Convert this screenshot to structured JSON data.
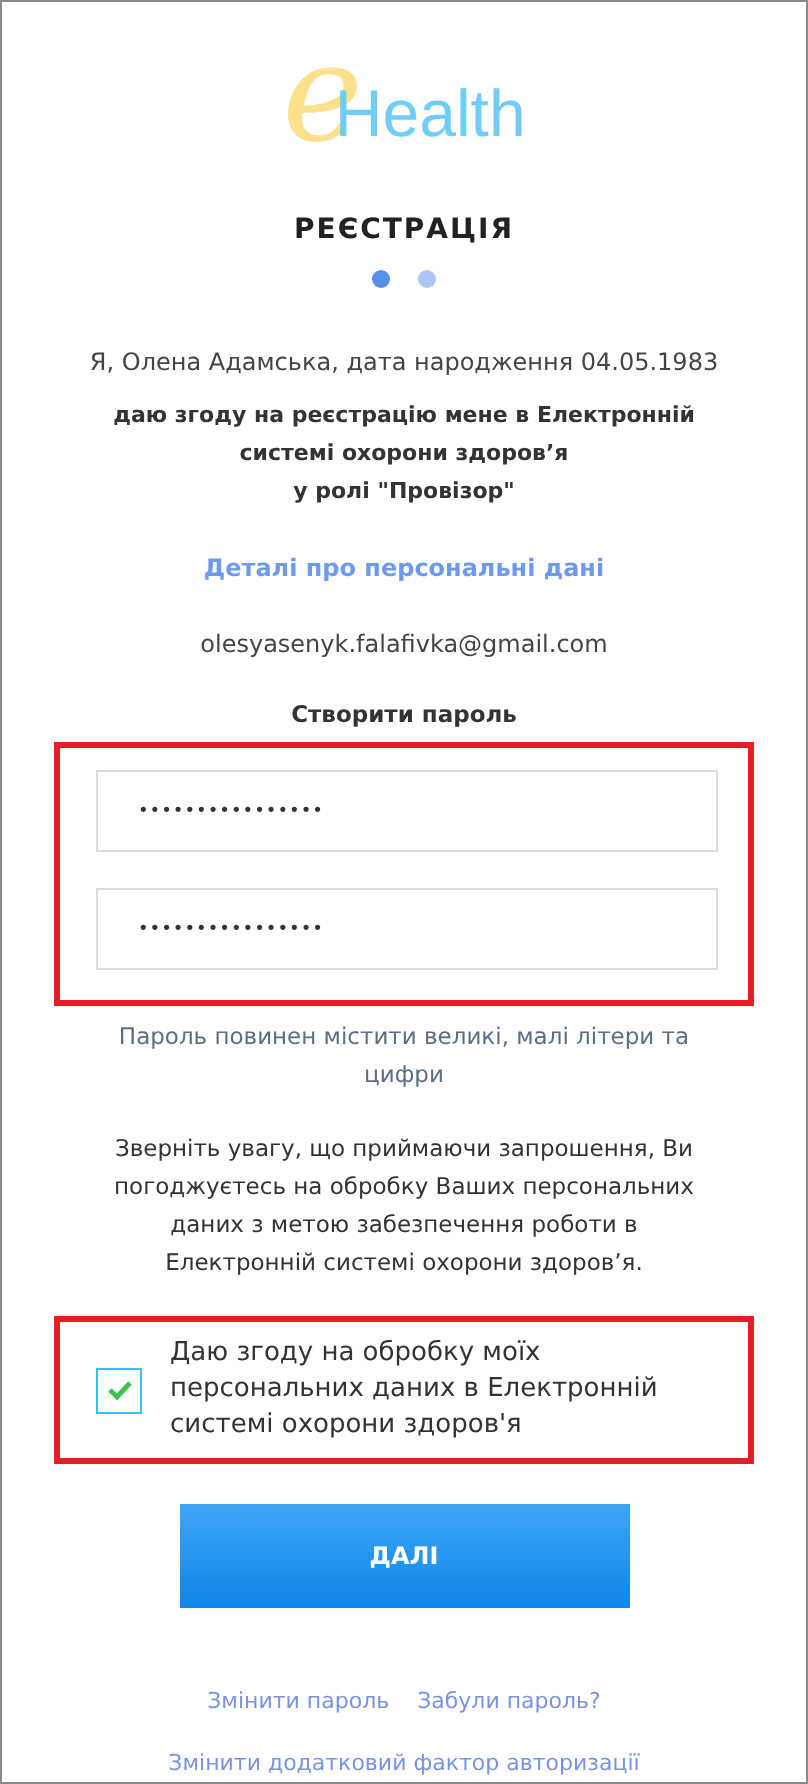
{
  "logo": {
    "mark": "e",
    "word": "Health"
  },
  "title": "РЕЄСТРАЦІЯ",
  "steps": [
    {
      "selected": true
    },
    {
      "selected": false
    }
  ],
  "identity": "Я, Олена Адамська, дата народження 04.05.1983",
  "consent_statement": "даю згоду на реєстрацію мене в Електронній системі охорони здоров’я\nу ролі \"Провізор\"",
  "details_link": "Деталі про персональні дані",
  "email": "olesyasenyk.falafivka@gmail.com",
  "password_heading": "Створити пароль",
  "password_fields": [
    {
      "value": "••••••••••••••••"
    },
    {
      "value": "••••••••••••••••"
    }
  ],
  "password_hint": "Пароль повинен містити великі, малі літери та цифри",
  "notice": "Зверніть увагу, що приймаючи запрошення, Ви погоджуєтесь на обробку Ваших персональних даних з метою забезпечення роботи в Електронній системі охорони здоров’я.",
  "agreement": {
    "label": "Даю згоду на обробку моїх персональних даних в Електронній системі охорони здоров'я",
    "checked": true
  },
  "next_button": "ДАЛІ",
  "links": [
    {
      "label": "Змінити пароль"
    },
    {
      "label": "Забули пароль?"
    }
  ],
  "bottom_link": "Змінити додатковий фактор авторизації"
}
